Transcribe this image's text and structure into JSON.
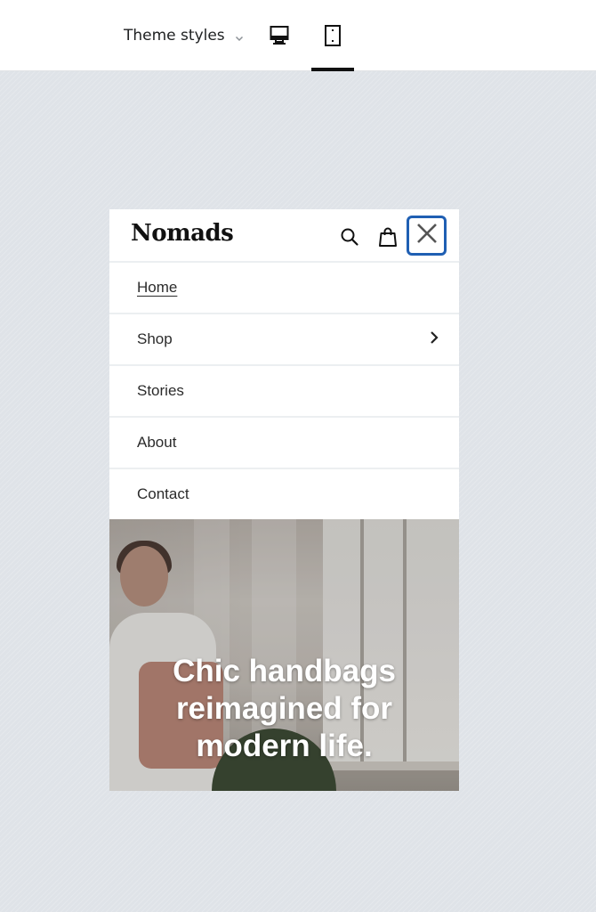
{
  "toolbar": {
    "theme_styles_label": "Theme styles",
    "devices": [
      {
        "name": "desktop",
        "icon": "desktop-icon",
        "active": false
      },
      {
        "name": "mobile",
        "icon": "mobile-icon",
        "active": true
      }
    ]
  },
  "store": {
    "logo": "Nomads",
    "header_icons": [
      "search-icon",
      "shopping-bag-icon",
      "close-icon"
    ],
    "focus_color": "#1f5fb3",
    "menu": [
      {
        "label": "Home",
        "active": true,
        "has_submenu": false
      },
      {
        "label": "Shop",
        "active": false,
        "has_submenu": true
      },
      {
        "label": "Stories",
        "active": false,
        "has_submenu": false
      },
      {
        "label": "About",
        "active": false,
        "has_submenu": false
      },
      {
        "label": "Contact",
        "active": false,
        "has_submenu": false
      }
    ],
    "hero": {
      "title": "Chic handbags reimagined for modern life."
    }
  }
}
